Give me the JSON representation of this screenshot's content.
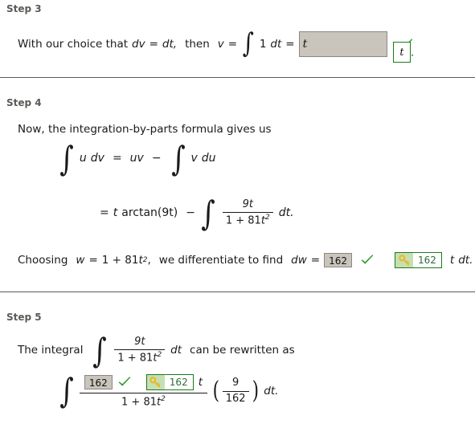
{
  "page": {
    "background": "#ffffff",
    "text_color": "#1a1a1a",
    "step_label_color": "#5a5a56",
    "answer_box_bg": "#c9c5bd",
    "check_color": "#2e9e2e",
    "key_border_color": "#1a7a1a",
    "key_icon_bg": "#c6e0b4",
    "key_value_color": "#2e6b3e"
  },
  "steps": [
    {
      "label": "Step 3",
      "line1": {
        "lead": "With our choice that",
        "dv": "dv",
        "eq1": "=",
        "dt": "dt,",
        "then": "then",
        "v": "v",
        "eq2": "=",
        "integral_glyph": "∫",
        "integrand": "1",
        "d_var": "dt",
        "eq3": "=",
        "answer_value": "t",
        "check_icon": "green-check-icon",
        "key_value": "t",
        "trailing": "."
      }
    },
    {
      "label": "Step 4",
      "intro": "Now, the integration-by-parts formula gives us",
      "formula1": {
        "integral_glyph": "∫",
        "u": "u",
        "dv": "dv",
        "eq": "=",
        "uv": "uv",
        "minus": "−",
        "integral_glyph2": "∫",
        "v": "v",
        "du": "du"
      },
      "formula2": {
        "eq": "=",
        "t": "t",
        "arctan": "arctan(9t)",
        "minus": "−",
        "integral_glyph": "∫",
        "numerator": "9t",
        "denominator_a": "1 + 81",
        "denominator_t": "t",
        "denominator_exp": "2",
        "d_var": "dt."
      },
      "choosing": {
        "lead": "Choosing",
        "w": "w",
        "eq1": "=",
        "expr_a": "1 + 81",
        "expr_t": "t",
        "expr_exp": "2",
        "comma": ",",
        "mid": "we differentiate to find",
        "dw": "dw",
        "eq2": "=",
        "answer_value": "162",
        "check_icon": "green-check-icon",
        "key_icon": "key-icon",
        "key_value": "162",
        "tail_t": "t",
        "tail_dt": "dt."
      }
    },
    {
      "label": "Step 5",
      "line1": {
        "lead": "The integral",
        "integral_glyph": "∫",
        "numerator": "9t",
        "denominator_a": "1 + 81",
        "denominator_t": "t",
        "denominator_exp": "2",
        "d_var": "dt",
        "tail": "can be rewritten as"
      },
      "formula": {
        "integral_glyph": "∫",
        "answer_value": "162",
        "check_icon": "green-check-icon",
        "key_icon": "key-icon",
        "key_value": "162",
        "num_t": "t",
        "denominator_a": "1 + 81",
        "denominator_t": "t",
        "denominator_exp": "2",
        "paren_open": "(",
        "paren_num": "9",
        "paren_den": "162",
        "paren_close": ")",
        "d_var": "dt."
      }
    }
  ]
}
